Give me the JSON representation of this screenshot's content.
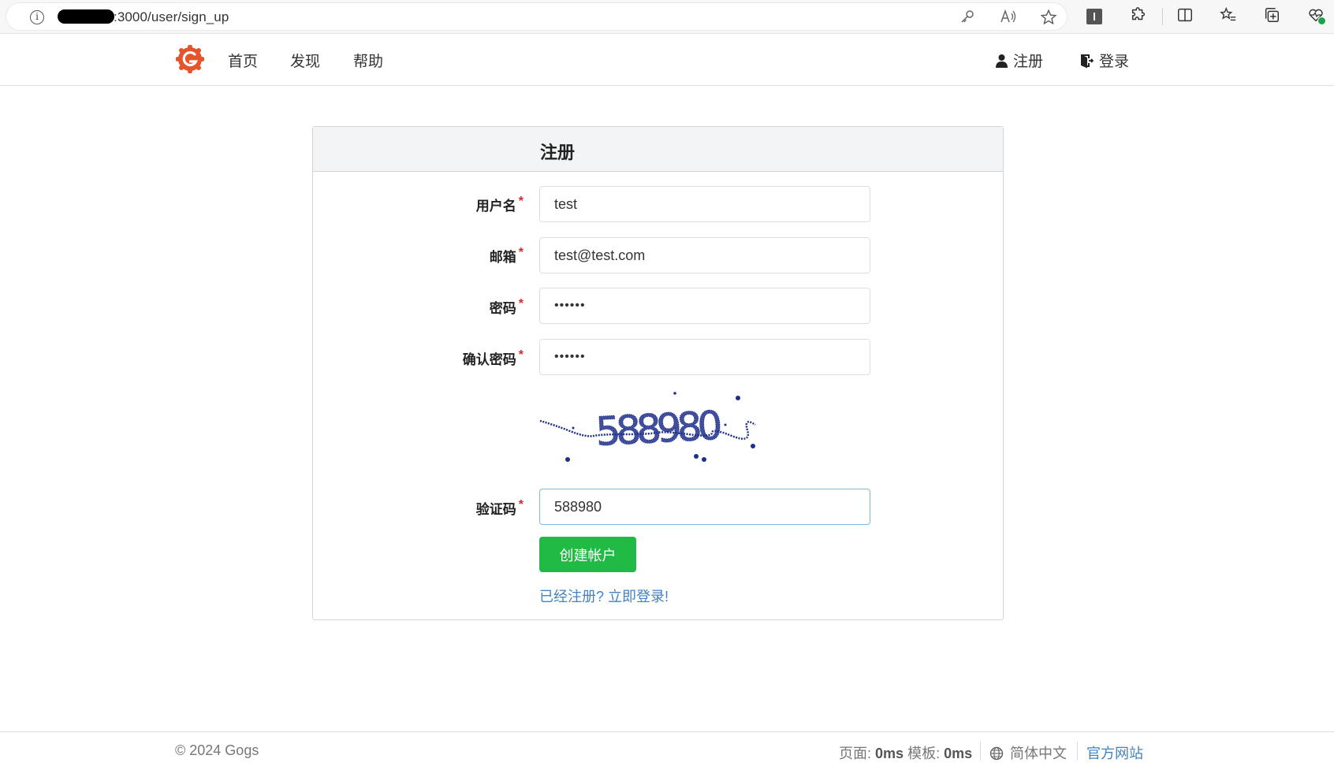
{
  "browser": {
    "url_visible": ":3000/user/sign_up",
    "icons": [
      "info-icon",
      "key-icon",
      "read-aloud-icon",
      "favorite-star-icon",
      "extension-square-icon",
      "extensions-puzzle-icon",
      "split-screen-icon",
      "favorites-list-icon",
      "collections-icon",
      "browser-health-icon"
    ]
  },
  "header": {
    "nav": {
      "home": "首页",
      "explore": "发现",
      "help": "帮助"
    },
    "register": "注册",
    "login": "登录",
    "brand_color": "#e5542b"
  },
  "form": {
    "title": "注册",
    "required_mark": "*",
    "fields": {
      "username": {
        "label": "用户名",
        "value": "test"
      },
      "email": {
        "label": "邮箱",
        "value": "test@test.com"
      },
      "password": {
        "label": "密码",
        "value": "••••••"
      },
      "confirm": {
        "label": "确认密码",
        "value": "••••••"
      },
      "captcha": {
        "label": "验证码",
        "value": "588980"
      }
    },
    "captcha_image_text": "588980",
    "submit": "创建帐户",
    "signin_link": "已经注册? 立即登录!",
    "button_color": "#21ba45",
    "link_color": "#4183c4"
  },
  "footer": {
    "copyright": "© 2024 Gogs",
    "page_label": "页面:",
    "page_time": "0ms",
    "template_label": "模板:",
    "template_time": "0ms",
    "language": "简体中文",
    "official_site": "官方网站"
  }
}
